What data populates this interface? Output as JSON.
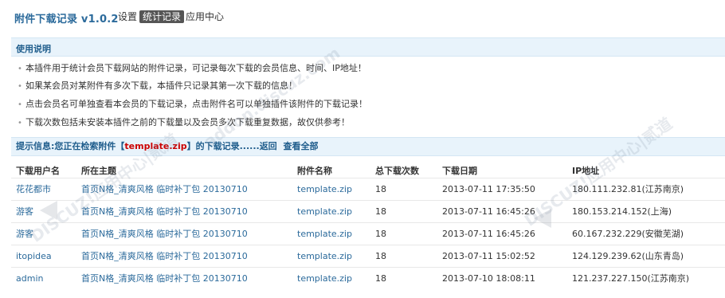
{
  "header": {
    "title": "附件下载记录 v1.0.2",
    "tabs": [
      {
        "label": "设置"
      },
      {
        "label": "统计记录"
      },
      {
        "label": "应用中心"
      }
    ]
  },
  "help": {
    "title": "使用说明",
    "items": [
      "本插件用于统计会员下载网站的附件记录，可记录每次下载的会员信息、时间、IP地址！",
      "如果某会员对某附件有多次下载，本插件只记录其第一次下载的信息！",
      "点击会员名可单独查看本会员的下载记录，点击附件名可以单独插件该附件的下载记录！",
      "下载次数包括未安装本插件之前的下载量以及会员多次下载重复数据，故仅供参考！"
    ]
  },
  "notice": {
    "prefix": "提示信息:您正在检索附件【",
    "file": "template.zip",
    "suffix": "】的下载记录......",
    "back": "返回",
    "view_all": "查看全部"
  },
  "table": {
    "headers": [
      "下载用户名",
      "所在主题",
      "附件名称",
      "总下载次数",
      "下载日期",
      "IP地址"
    ],
    "rows": [
      {
        "user": "花花都市",
        "topic": "首页N格_清爽风格 临时补丁包 20130710",
        "file": "template.zip",
        "count": "18",
        "date": "2013-07-11 17:35:50",
        "ip": "180.111.232.81(江苏南京)"
      },
      {
        "user": "游客",
        "topic": "首页N格_清爽风格 临时补丁包 20130710",
        "file": "template.zip",
        "count": "18",
        "date": "2013-07-11 16:45:26",
        "ip": "180.153.214.152(上海)"
      },
      {
        "user": "游客",
        "topic": "首页N格_清爽风格 临时补丁包 20130710",
        "file": "template.zip",
        "count": "18",
        "date": "2013-07-11 16:45:26",
        "ip": "60.167.232.229(安徽芜湖)"
      },
      {
        "user": "itopidea",
        "topic": "首页N格_清爽风格 临时补丁包 20130710",
        "file": "template.zip",
        "count": "18",
        "date": "2013-07-11 15:02:52",
        "ip": "124.129.239.62(山东青岛)"
      },
      {
        "user": "admin",
        "topic": "首页N格_清爽风格 临时补丁包 20130710",
        "file": "template.zip",
        "count": "18",
        "date": "2013-07-10 18:08:11",
        "ip": "121.237.227.150(江苏南京)"
      }
    ]
  },
  "watermark": {
    "text": "DISCUZ!应用中心|贰道",
    "url": "addon.discuz.com"
  },
  "colors": {
    "accent": "#2b6a9b",
    "notice_file": "#cc0000",
    "active_tab_bg": "#555555",
    "panel_bg": "#e8f3fb"
  }
}
